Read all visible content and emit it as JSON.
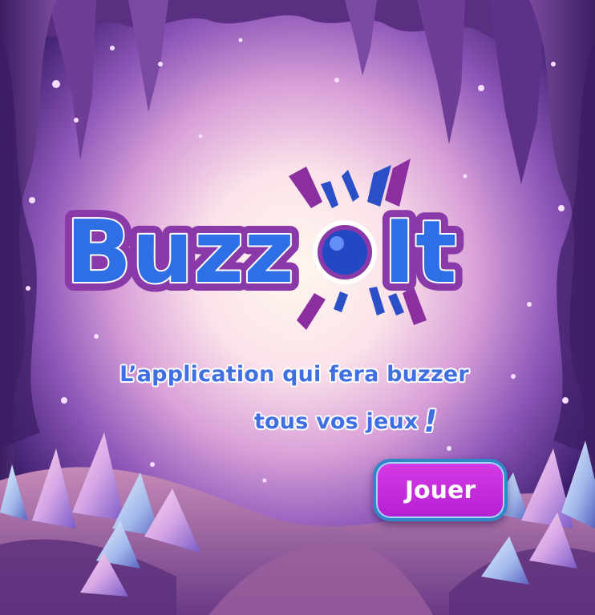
{
  "logo": {
    "word_left": "Buzz",
    "word_right": "It"
  },
  "tagline": {
    "line1": "L’application qui fera buzzer",
    "line2": "tous vos jeux",
    "exclamation": "!"
  },
  "play_button": {
    "label": "Jouer"
  },
  "colors": {
    "logo_blue": "#2f6fe6",
    "logo_outline": "#8a3aa8",
    "spark_purple": "#8b2fa0",
    "spark_blue": "#2a4fc7",
    "tagline_blue": "#3f6fe0",
    "button_fill": "#c72fe0",
    "button_border": "#2f86c9"
  }
}
